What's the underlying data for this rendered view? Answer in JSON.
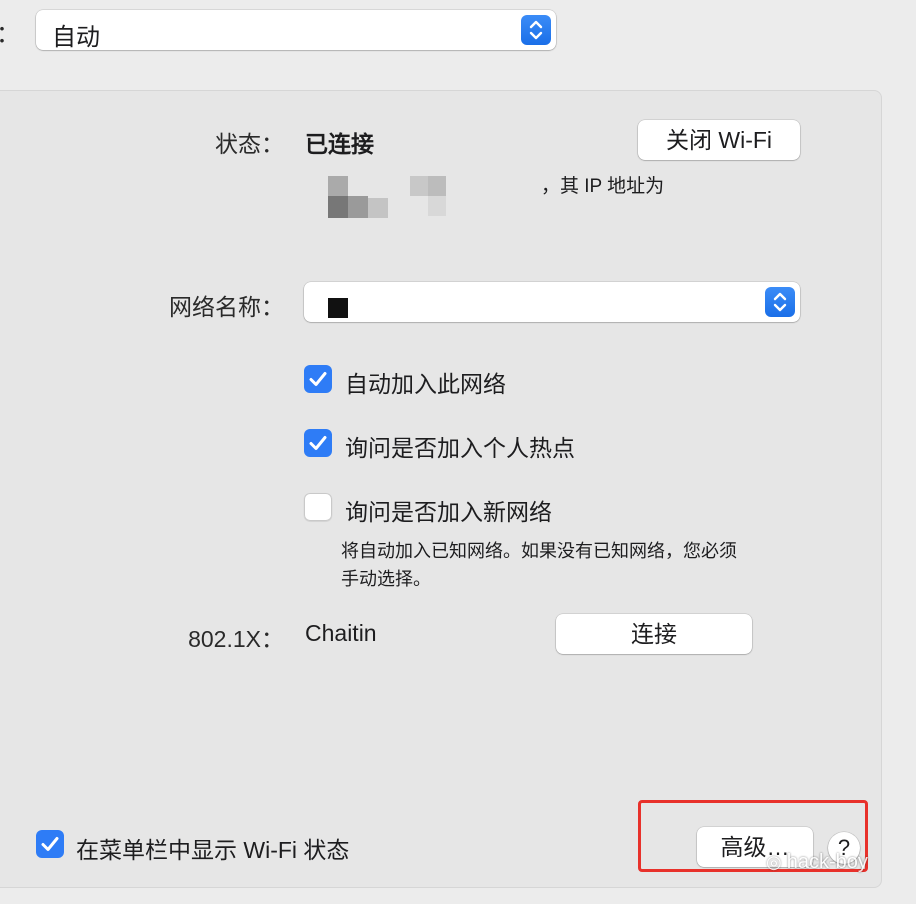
{
  "location": {
    "label": "：",
    "value": "自动"
  },
  "status": {
    "label": "状态：",
    "value": "已连接",
    "turn_off_button": "关闭 Wi-Fi",
    "description": "，其 IP 地址为"
  },
  "network_name": {
    "label": "网络名称："
  },
  "options": [
    {
      "label": "自动加入此网络",
      "checked": true
    },
    {
      "label": "询问是否加入个人热点",
      "checked": true
    },
    {
      "label": "询问是否加入新网络",
      "checked": false
    }
  ],
  "note": {
    "line1": "将自动加入已知网络。如果没有已知网络，您必须",
    "line2": "手动选择。"
  },
  "dot1x": {
    "label": "802.1X：",
    "value": "Chaitin",
    "connect_button": "连接"
  },
  "menubar_option": {
    "label": "在菜单栏中显示 Wi-Fi 状态",
    "checked": true
  },
  "advanced_button": "高级…",
  "help_button": "?",
  "watermark": "hack-boy",
  "colors": {
    "accent": "#2e7cf6",
    "highlight": "#e8312b"
  }
}
